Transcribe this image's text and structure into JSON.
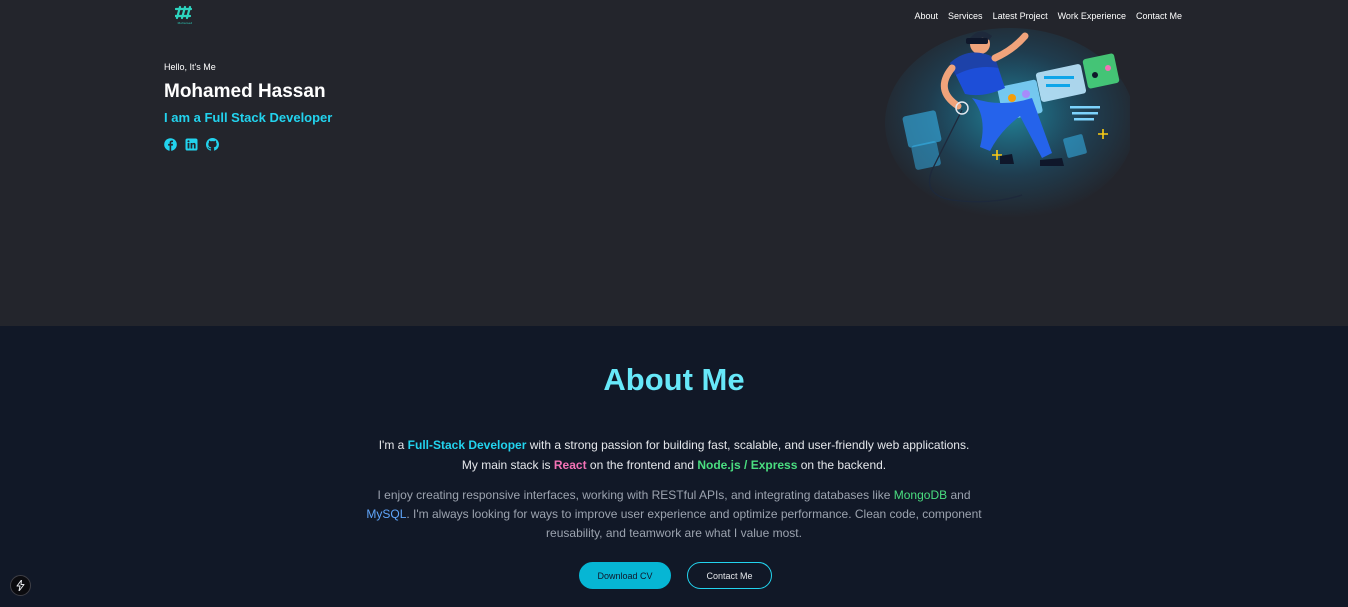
{
  "header": {
    "logo_text": "Mohamed",
    "nav": [
      "About",
      "Services",
      "Latest Project",
      "Work Experience",
      "Contact Me"
    ]
  },
  "hero": {
    "greeting": "Hello, It's Me",
    "name": "Mohamed Hassan",
    "role": "I am a Full Stack Developer",
    "socials": [
      "facebook-icon",
      "linkedin-icon",
      "github-icon"
    ]
  },
  "about": {
    "title": "About Me",
    "p1": {
      "t1": "I'm a ",
      "h1": "Full-Stack Developer",
      "t2": " with a strong passion for building fast, scalable, and user-friendly web applications. My main stack is ",
      "h2": "React",
      "t3": " on the frontend and ",
      "h3": "Node.js / Express",
      "t4": " on the backend."
    },
    "p2": {
      "t1": "I enjoy creating responsive interfaces, working with RESTful APIs, and integrating databases like ",
      "h1": "MongoDB",
      "t2": " and ",
      "h2": "MySQL",
      "t3": ". I'm always looking for ways to improve user experience and optimize performance. Clean code, component reusability, and teamwork are what I value most."
    },
    "download_label": "Download CV",
    "contact_label": "Contact Me"
  },
  "colors": {
    "hero_bg": "#23252c",
    "page_bg": "#111827",
    "accent": "#22d3ee"
  }
}
